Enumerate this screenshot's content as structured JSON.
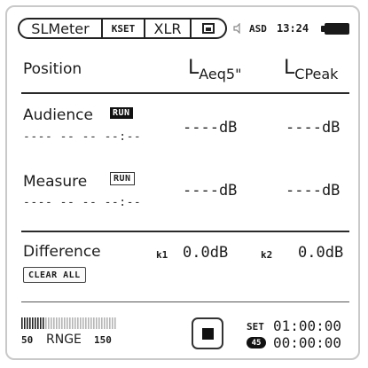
{
  "status_bar": {
    "mode_tab": "SLMeter",
    "kset_tab": "KSET",
    "input_tab": "XLR",
    "save_icon": "save-icon",
    "speaker_icon": "speaker-icon",
    "asd_label": "ASD",
    "time": "13:24",
    "battery_icon": "battery-icon"
  },
  "table": {
    "col_position": "Position",
    "col_laeq": "L",
    "col_laeq_sub": "Aeq5\"",
    "col_lcpeak": "L",
    "col_lcpeak_sub": "CPeak"
  },
  "rows": [
    {
      "label": "Audience",
      "run_label": "RUN",
      "timestamp": "---- -- --  --:--",
      "laeq": "----dB",
      "lcpeak": "----dB"
    },
    {
      "label": "Measure",
      "run_label": "RUN",
      "timestamp": "---- -- --  --:--",
      "laeq": "----dB",
      "lcpeak": "----dB"
    }
  ],
  "difference": {
    "label": "Difference",
    "k1_label": "k1",
    "k1_value": "0.0dB",
    "k2_label": "k2",
    "k2_value": "0.0dB",
    "clear_all": "CLEAR ALL"
  },
  "footer": {
    "range_min": "50",
    "range_label": "RNGE",
    "range_max": "150",
    "set_label": "SET",
    "set_time": "01:00:00",
    "elapsed_icon_label": "45",
    "elapsed_time": "00:00:00",
    "stop_icon": "stop-icon"
  }
}
